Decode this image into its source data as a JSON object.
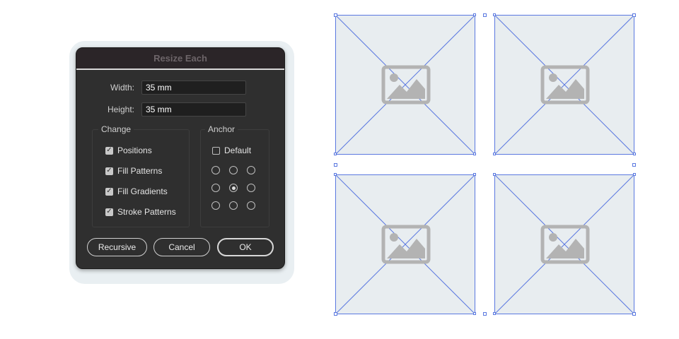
{
  "dialog": {
    "title": "Resize Each",
    "width": {
      "label": "Width:",
      "value": "35 mm"
    },
    "height": {
      "label": "Height:",
      "value": "35 mm"
    },
    "change": {
      "label": "Change",
      "options": [
        {
          "label": "Positions",
          "checked": true
        },
        {
          "label": "Fill Patterns",
          "checked": true
        },
        {
          "label": "Fill Gradients",
          "checked": true
        },
        {
          "label": "Stroke Patterns",
          "checked": true
        }
      ]
    },
    "anchor": {
      "label": "Anchor",
      "default_label": "Default",
      "default_checked": false,
      "selected": "center"
    },
    "buttons": {
      "recursive": "Recursive",
      "cancel": "Cancel",
      "ok": "OK"
    }
  },
  "canvas": {
    "tile_count": 4,
    "placeholder_icon": "image-placeholder-icon",
    "colors": {
      "selection": "#5a78e0",
      "tile_fill": "#e8edf0",
      "icon": "#b3b3b3"
    }
  },
  "colors": {
    "dialog_bg": "#2f2f2f",
    "title_text": "#6d6569",
    "text": "#e4e4e4"
  }
}
